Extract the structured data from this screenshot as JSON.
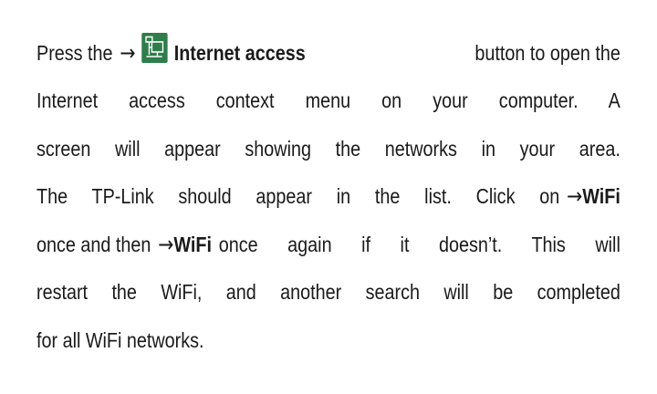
{
  "paragraph": {
    "line1": {
      "press": "Press the",
      "arrow": "→",
      "button_label": "Internet access",
      "rest": "button to open the"
    },
    "line2": "Internet access context menu on your computer. A",
    "line3": "screen will appear showing the networks in your area.",
    "line4": {
      "text": "The TP-Link should appear in the list. Click on",
      "arrow": "→",
      "wifi": "WiFi"
    },
    "line5": {
      "pre": "once and then",
      "arrow": "→",
      "wifi": "WiFi",
      "post": "once again if it doesn’t. This will"
    },
    "line6": "restart the WiFi, and another search will be completed",
    "line7": "for all WiFi networks."
  },
  "icons": {
    "network": "network-computer-icon",
    "icon_color": "#2e7d4a"
  }
}
